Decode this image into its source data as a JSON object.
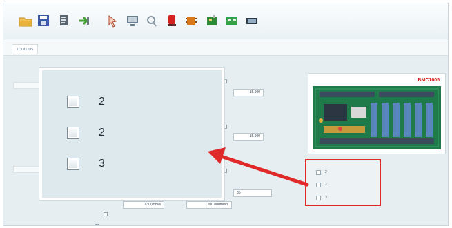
{
  "toolbar": {
    "buttons": [
      {
        "name": "open-folder-icon",
        "color": "#e9b23a"
      },
      {
        "name": "save-icon",
        "color": "#3a5aa8"
      },
      {
        "name": "document-icon",
        "color": "#5b6770"
      },
      {
        "name": "export-arrow-icon",
        "color": "#4aa33a"
      },
      {
        "name": "pointer-icon",
        "color": "#b04a2a"
      },
      {
        "name": "monitor-icon",
        "color": "#6a7d8c"
      },
      {
        "name": "search-icon",
        "color": "#8a98a3"
      },
      {
        "name": "stop-icon",
        "color": "#d62020"
      },
      {
        "name": "chip-icon",
        "color": "#d8781a"
      },
      {
        "name": "board-icon",
        "color": "#2f8a3a"
      },
      {
        "name": "green-board-icon",
        "color": "#34a04a"
      },
      {
        "name": "keyboard-icon",
        "color": "#2c3a48"
      }
    ]
  },
  "tab": {
    "label": "TOOLOUS"
  },
  "panel": {
    "field_1": "15.600",
    "field_2": "15.600",
    "field_3": "36",
    "field_4": "0.300mm/s",
    "field_5": "200.000mm/s"
  },
  "board_card": {
    "title": "BMC1605"
  },
  "zoom_checkboxes": [
    {
      "label": "2"
    },
    {
      "label": "2"
    },
    {
      "label": "3"
    }
  ],
  "highlight_checkboxes": [
    {
      "label": "2"
    },
    {
      "label": "2"
    },
    {
      "label": "3"
    }
  ],
  "colors": {
    "accent_red": "#e02a2a",
    "board_green": "#1f7a4a"
  }
}
